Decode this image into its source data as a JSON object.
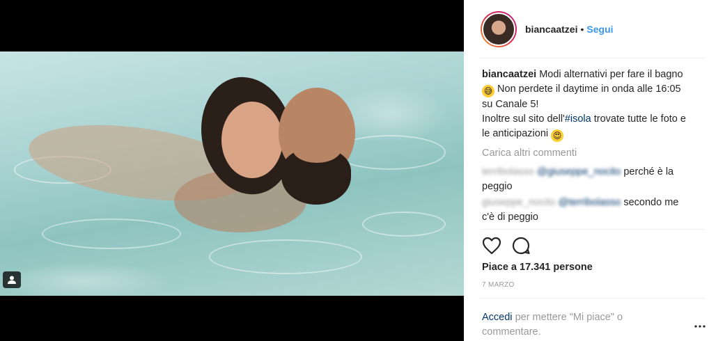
{
  "post": {
    "username": "biancaatzei",
    "follow_label": "Segui",
    "caption": {
      "username": "biancaatzei",
      "text_part1": "Modi alternativi per fare il bagno",
      "text_part2": "Non perdete il daytime in onda alle 16:05 su Canale 5!",
      "text_part3": "Inoltre sul sito dell'",
      "hashtag": "#isola",
      "text_part4": "trovate tutte le foto e le anticipazioni"
    },
    "load_more_label": "Carica altri commenti",
    "comments": [
      {
        "username": "terribolasso",
        "mention": "@giuseppe_nocito",
        "text": "perché è la peggio"
      },
      {
        "username": "giuseppe_nocito",
        "mention": "@terribolasso",
        "text": "secondo me c'è di peggio"
      }
    ],
    "likes_text": "Piace a 17.341 persone",
    "date": "7 MARZO",
    "login_link": "Accedi",
    "login_text": "per mettere \"Mi piace\" o commentare."
  },
  "icons": {
    "heart": "heart-icon",
    "comment": "comment-icon",
    "more": "more-options-icon",
    "tagged_user": "tagged-user-icon"
  },
  "colors": {
    "link_blue": "#3897f0",
    "hashtag_blue": "#003569",
    "muted": "#999999"
  }
}
